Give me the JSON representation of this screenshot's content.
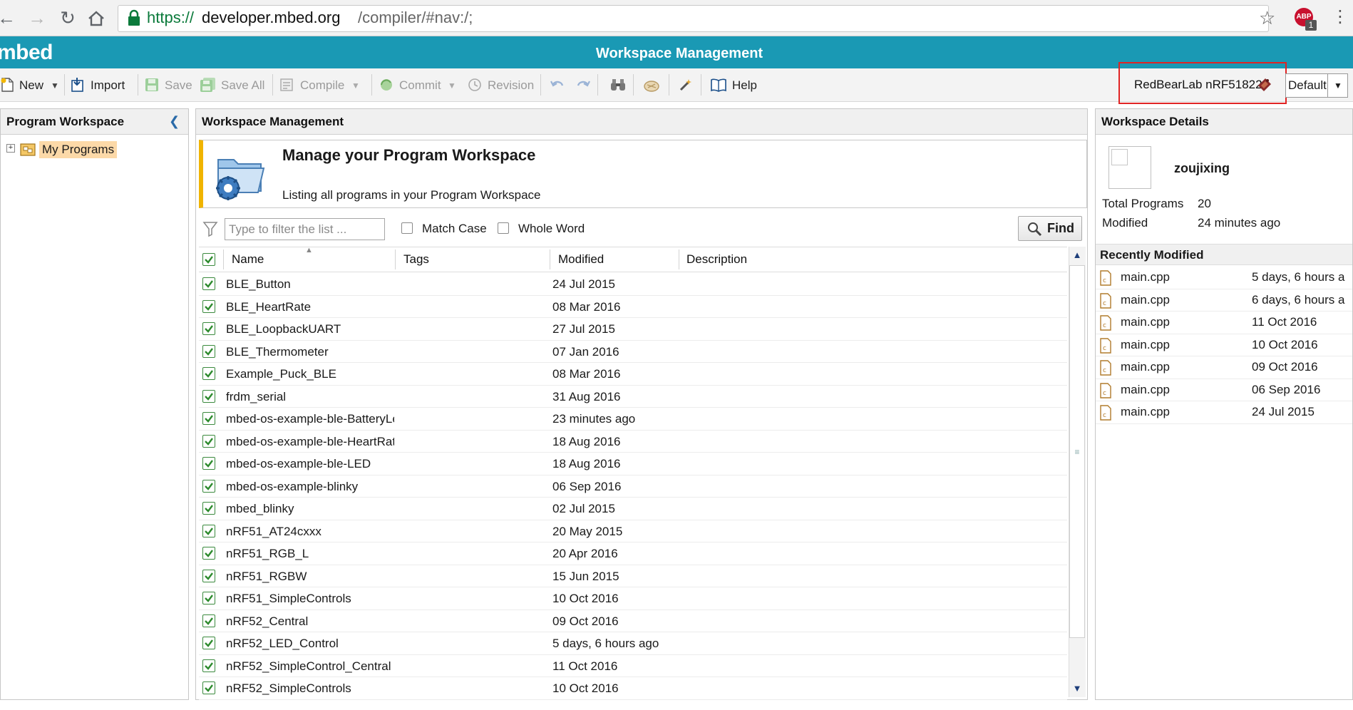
{
  "browser": {
    "url_scheme": "https://",
    "url_host": "developer.mbed.org",
    "url_path": "/compiler/#nav:/;",
    "abp_label": "ABP",
    "abp_count": "1"
  },
  "app": {
    "logo": "mbed",
    "title": "Workspace Management",
    "accent_color": "#1a99b4"
  },
  "toolbar": {
    "new_label": "New",
    "import_label": "Import",
    "save_label": "Save",
    "save_all_label": "Save All",
    "compile_label": "Compile",
    "commit_label": "Commit",
    "revision_label": "Revision",
    "help_label": "Help",
    "target_label": "RedBearLab nRF51822",
    "build_profile": "Default"
  },
  "left_panel": {
    "title": "Program Workspace",
    "tree_root": "My Programs"
  },
  "center_panel": {
    "title": "Workspace Management",
    "banner_title": "Manage your Program Workspace",
    "banner_subtitle": "Listing all programs in your Program Workspace",
    "filter_placeholder": "Type to filter the list ...",
    "match_case_label": "Match Case",
    "whole_word_label": "Whole Word",
    "find_label": "Find",
    "columns": [
      "Name",
      "Tags",
      "Modified",
      "Description"
    ],
    "programs": [
      {
        "name": "BLE_Button",
        "modified": "24 Jul 2015"
      },
      {
        "name": "BLE_HeartRate",
        "modified": "08 Mar 2016"
      },
      {
        "name": "BLE_LoopbackUART",
        "modified": "27 Jul 2015"
      },
      {
        "name": "BLE_Thermometer",
        "modified": "07 Jan 2016"
      },
      {
        "name": "Example_Puck_BLE",
        "modified": "08 Mar 2016"
      },
      {
        "name": "frdm_serial",
        "modified": "31 Aug 2016"
      },
      {
        "name": "mbed-os-example-ble-BatteryLe",
        "modified": "23 minutes ago"
      },
      {
        "name": "mbed-os-example-ble-HeartRate",
        "modified": "18 Aug 2016"
      },
      {
        "name": "mbed-os-example-ble-LED",
        "modified": "18 Aug 2016"
      },
      {
        "name": "mbed-os-example-blinky",
        "modified": "06 Sep 2016"
      },
      {
        "name": "mbed_blinky",
        "modified": "02 Jul 2015"
      },
      {
        "name": "nRF51_AT24cxxx",
        "modified": "20 May 2015"
      },
      {
        "name": "nRF51_RGB_L",
        "modified": "20 Apr 2016"
      },
      {
        "name": "nRF51_RGBW",
        "modified": "15 Jun 2015"
      },
      {
        "name": "nRF51_SimpleControls",
        "modified": "10 Oct 2016"
      },
      {
        "name": "nRF52_Central",
        "modified": "09 Oct 2016"
      },
      {
        "name": "nRF52_LED_Control",
        "modified": "5 days, 6 hours ago"
      },
      {
        "name": "nRF52_SimpleControl_Central",
        "modified": "11 Oct 2016"
      },
      {
        "name": "nRF52_SimpleControls",
        "modified": "10 Oct 2016"
      }
    ]
  },
  "right_panel": {
    "title": "Workspace Details",
    "username": "zoujixing",
    "total_programs_label": "Total Programs",
    "total_programs_value": "20",
    "modified_label": "Modified",
    "modified_value": "24 minutes ago",
    "recent_title": "Recently Modified",
    "recent": [
      {
        "file": "main.cpp",
        "when": "5 days, 6 hours a"
      },
      {
        "file": "main.cpp",
        "when": "6 days, 6 hours a"
      },
      {
        "file": "main.cpp",
        "when": "11 Oct 2016"
      },
      {
        "file": "main.cpp",
        "when": "10 Oct 2016"
      },
      {
        "file": "main.cpp",
        "when": "09 Oct 2016"
      },
      {
        "file": "main.cpp",
        "when": "06 Sep 2016"
      },
      {
        "file": "main.cpp",
        "when": "24 Jul 2015"
      }
    ]
  },
  "icons": [
    "back-icon",
    "forward-icon",
    "reload-icon",
    "home-icon",
    "lock-icon",
    "star-icon",
    "adblock-icon",
    "menu-icon",
    "new-icon",
    "import-icon",
    "save-icon",
    "save-all-icon",
    "compile-icon",
    "commit-icon",
    "revision-icon",
    "undo-icon",
    "redo-icon",
    "binoculars-icon",
    "format-icon",
    "wand-icon",
    "help-book-icon",
    "board-icon",
    "collapse-icon",
    "programs-folder-icon",
    "workspace-folder-icon",
    "filter-icon",
    "search-icon",
    "checkbox-checked-icon",
    "cpp-file-icon"
  ]
}
